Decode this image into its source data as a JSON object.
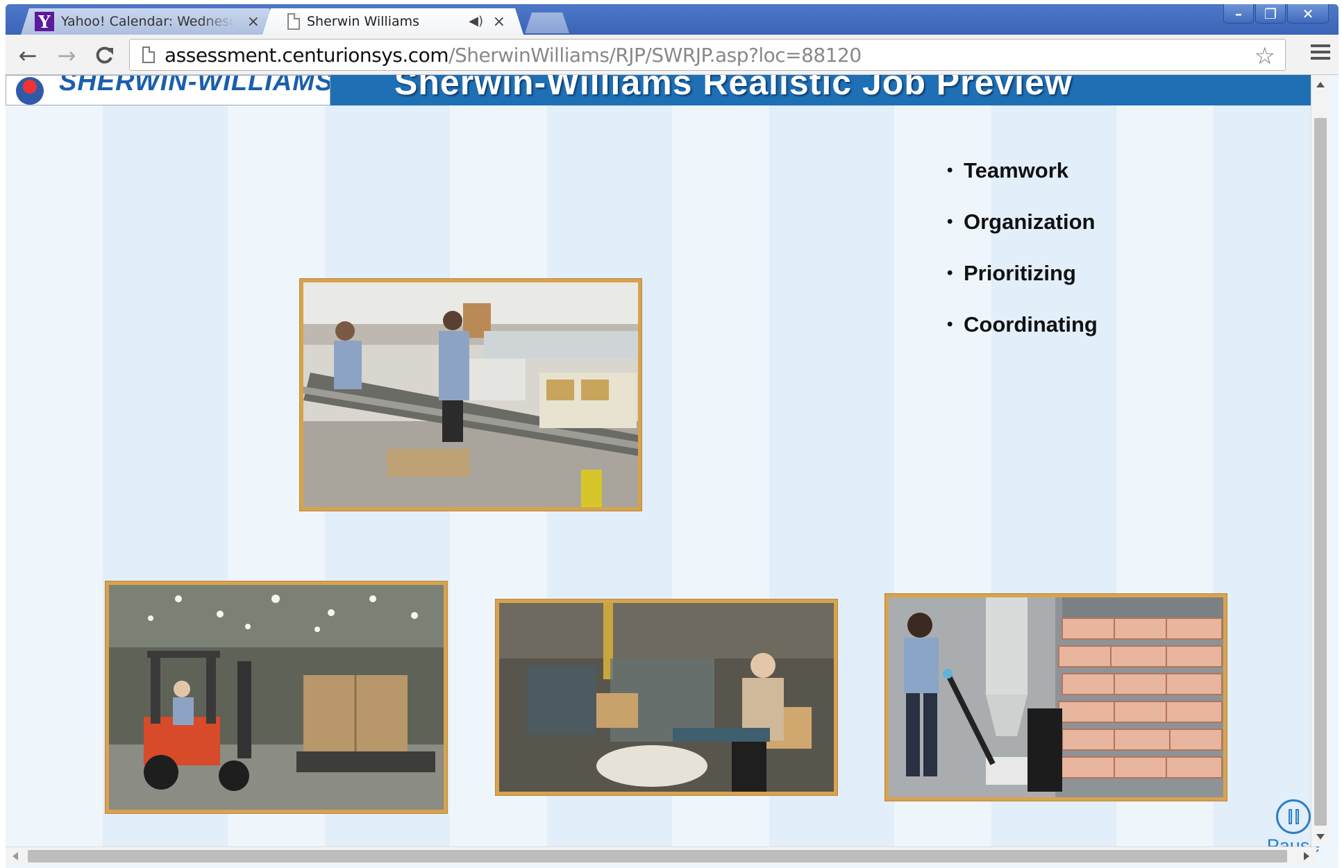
{
  "browser": {
    "tabs": [
      {
        "favicon": "yahoo-icon",
        "title": "Yahoo! Calendar: Wednesda",
        "close": "×"
      },
      {
        "favicon": "document-icon",
        "title": "Sherwin Williams",
        "audio": "◀)",
        "close": "×"
      }
    ],
    "window_controls": {
      "minimize": "–",
      "maximize": "❐",
      "close": "✕"
    },
    "nav": {
      "back": "←",
      "forward": "→",
      "reload": "C"
    },
    "address": {
      "host": "assessment.centurionsys.com",
      "path": "/SherwinWilliams/RJP/SWRJP.asp?loc=88120"
    },
    "bookmark_star": "☆"
  },
  "page": {
    "logo_text": "SHERWIN-WILLIAMS.",
    "heading": "Sherwin-Williams Realistic Job Preview",
    "skills": [
      "Teamwork",
      "Organization",
      "Prioritizing",
      "Coordinating"
    ],
    "bullet": "•",
    "photos": [
      {
        "name": "conveyor-photo",
        "subject": "workers packing paint buckets at a roller conveyor"
      },
      {
        "name": "forklift-photo",
        "subject": "forklift operator moving pallet of boxes in warehouse"
      },
      {
        "name": "boxing-photo",
        "subject": "worker assembling cardboard boxes on a line"
      },
      {
        "name": "pallet-jack-photo",
        "subject": "worker pulling pallet jack of stacked bags"
      }
    ],
    "pause_label": "Pause"
  },
  "colors": {
    "header_blue": "#1f6fb5",
    "logo_blue": "#1a5fae",
    "photo_frame": "#d8a24e",
    "pause_blue": "#2b7fc6",
    "stage_light": "#eef6fb",
    "stage_stripe": "#e2eef9"
  }
}
